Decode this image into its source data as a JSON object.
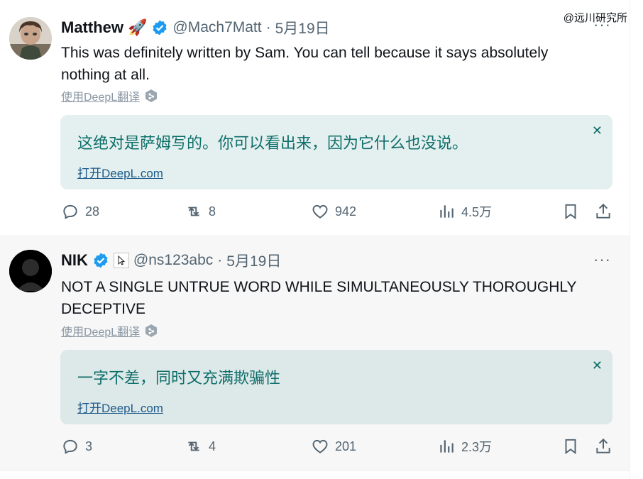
{
  "watermark": "@远川研究所",
  "tweets": [
    {
      "name": "Matthew",
      "emoji": "🚀",
      "handle": "@Mach7Matt",
      "dot": "·",
      "date": "5月19日",
      "more": "···",
      "text": "This was definitely written by Sam. You can tell because it says absolutely nothing at all.",
      "translate_link": "使用DeepL翻译",
      "translation": "这绝对是萨姆写的。你可以看出来，因为它什么也没说。",
      "open_deepl": "打开DeepL.com",
      "close": "✕",
      "replies": "28",
      "retweets": "8",
      "likes": "942",
      "views": "4.5万"
    },
    {
      "name": "NIK",
      "handle": "@ns123abc",
      "dot": "·",
      "date": "5月19日",
      "more": "···",
      "text": "NOT A SINGLE UNTRUE WORD WHILE SIMULTANEOUSLY THOROUGHLY DECEPTIVE",
      "translate_link": "使用DeepL翻译",
      "translation": "一字不差，同时又充满欺骗性",
      "open_deepl": "打开DeepL.com",
      "close": "✕",
      "replies": "3",
      "retweets": "4",
      "likes": "201",
      "views": "2.3万"
    }
  ],
  "colors": {
    "verified": "#1d9bf0",
    "translation_text": "#0e6e6a",
    "secondary_text": "#536471"
  },
  "icons": [
    "reply-icon",
    "retweet-icon",
    "like-icon",
    "views-icon",
    "bookmark-icon",
    "share-icon",
    "verified-icon",
    "deepl-icon",
    "more-icon",
    "close-icon",
    "cursor-icon"
  ]
}
